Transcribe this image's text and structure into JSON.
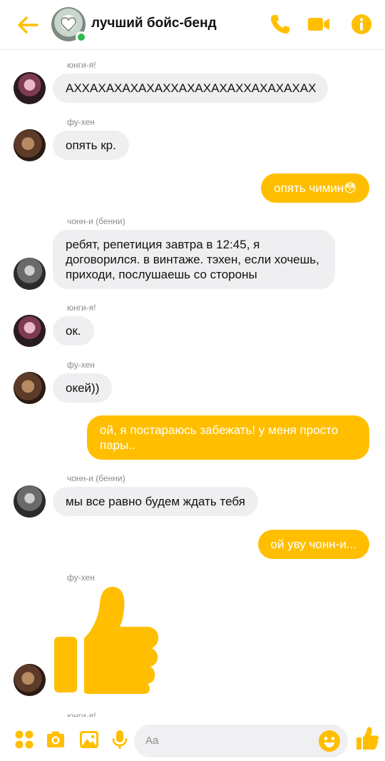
{
  "header": {
    "title": "лучший бойс-бенд",
    "accent_color": "#FFBF00",
    "icons": [
      "back-arrow-icon",
      "phone-icon",
      "video-camera-icon",
      "info-icon"
    ]
  },
  "messages": [
    {
      "sender": "юнги-я!",
      "text": "АХХАХАХАХАХАХХАХАХАХАХХАХАХАХАХ",
      "direction": "in",
      "avatar": "yungi"
    },
    {
      "sender": "фу-хен",
      "text": "опять кр.",
      "direction": "in",
      "avatar": "fuhen"
    },
    {
      "text": "опять чимин😳",
      "direction": "out"
    },
    {
      "sender": "чонн-и (бенни)",
      "text": "ребят, репетиция завтра в 12:45, я договорился. в винтаже. тэхен, если хочешь, приходи, послушаешь со стороны",
      "direction": "in",
      "avatar": "chonni"
    },
    {
      "sender": "юнги-я!",
      "text": "ок.",
      "direction": "in",
      "avatar": "yungi"
    },
    {
      "sender": "фу-хен",
      "text": "окей))",
      "direction": "in",
      "avatar": "fuhen"
    },
    {
      "text": "ой, я постараюсь забежать! у меня просто пары..",
      "direction": "out"
    },
    {
      "sender": "чонн-и (бенни)",
      "text": "мы все равно будем ждать тебя",
      "direction": "in",
      "avatar": "chonni"
    },
    {
      "text": "ой уву чонн-и...",
      "direction": "out"
    },
    {
      "sender": "фу-хен",
      "text": "",
      "direction": "in",
      "avatar": "fuhen",
      "sticker": "thumbs-up"
    }
  ],
  "partial_sender": "юнги-я!",
  "composer": {
    "placeholder": "Aa",
    "icons": [
      "apps-grid-icon",
      "camera-icon",
      "image-icon",
      "microphone-icon",
      "emoji-icon",
      "like-icon"
    ]
  }
}
